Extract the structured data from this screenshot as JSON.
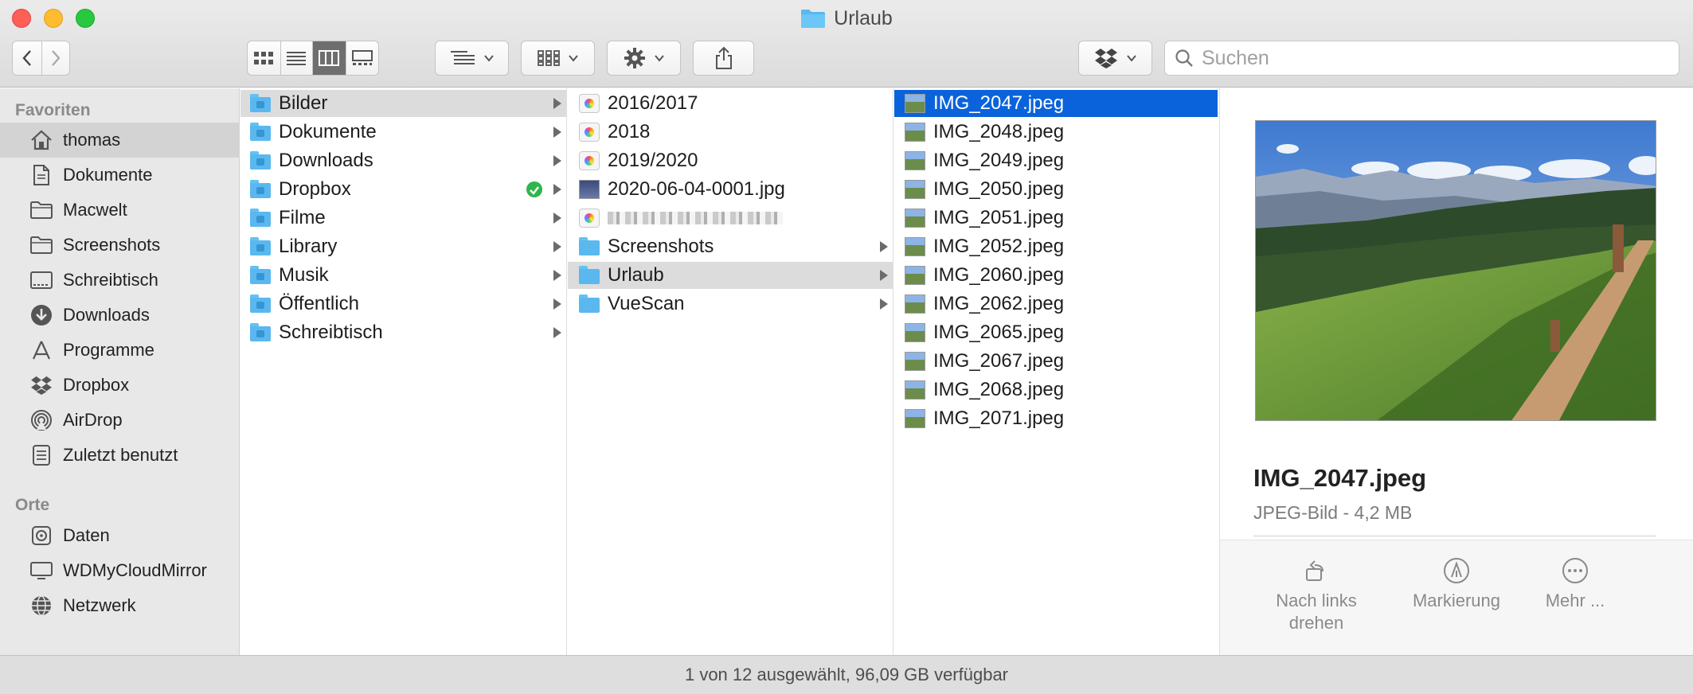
{
  "window": {
    "title": "Urlaub"
  },
  "toolbar": {
    "back_icon": "chevron-left-icon",
    "forward_icon": "chevron-right-icon",
    "view_modes": [
      "icon-view",
      "list-view",
      "column-view",
      "gallery-view"
    ],
    "active_view": "column-view",
    "search_placeholder": "Suchen"
  },
  "sidebar": {
    "favorites_header": "Favoriten",
    "favorites": [
      {
        "label": "thomas",
        "icon": "home-icon",
        "selected": true
      },
      {
        "label": "Dokumente",
        "icon": "document-icon"
      },
      {
        "label": "Macwelt",
        "icon": "folder-icon"
      },
      {
        "label": "Screenshots",
        "icon": "folder-icon"
      },
      {
        "label": "Schreibtisch",
        "icon": "desktop-icon"
      },
      {
        "label": "Downloads",
        "icon": "download-icon"
      },
      {
        "label": "Programme",
        "icon": "applications-icon"
      },
      {
        "label": "Dropbox",
        "icon": "dropbox-icon"
      },
      {
        "label": "AirDrop",
        "icon": "airdrop-icon"
      },
      {
        "label": "Zuletzt benutzt",
        "icon": "recents-icon"
      }
    ],
    "locations_header": "Orte",
    "locations": [
      {
        "label": "Daten",
        "icon": "disk-icon"
      },
      {
        "label": "WDMyCloudMirror",
        "icon": "display-icon"
      },
      {
        "label": "Netzwerk",
        "icon": "network-icon"
      }
    ]
  },
  "columns": {
    "col1": [
      {
        "label": "Bilder",
        "selected": true
      },
      {
        "label": "Dokumente"
      },
      {
        "label": "Downloads"
      },
      {
        "label": "Dropbox",
        "synced": true
      },
      {
        "label": "Filme"
      },
      {
        "label": "Library"
      },
      {
        "label": "Musik"
      },
      {
        "label": "Öffentlich"
      },
      {
        "label": "Schreibtisch"
      }
    ],
    "col2": [
      {
        "label": "2016/2017",
        "kind": "photos"
      },
      {
        "label": "2018",
        "kind": "photos"
      },
      {
        "label": "2019/2020",
        "kind": "photos"
      },
      {
        "label": "2020-06-04-0001.jpg",
        "kind": "jpg"
      },
      {
        "label": "",
        "kind": "photos",
        "blurred": true
      },
      {
        "label": "Screenshots",
        "kind": "folder"
      },
      {
        "label": "Urlaub",
        "kind": "folder",
        "selected": true
      },
      {
        "label": "VueScan",
        "kind": "folder"
      }
    ],
    "col3": [
      "IMG_2047.jpeg",
      "IMG_2048.jpeg",
      "IMG_2049.jpeg",
      "IMG_2050.jpeg",
      "IMG_2051.jpeg",
      "IMG_2052.jpeg",
      "IMG_2060.jpeg",
      "IMG_2062.jpeg",
      "IMG_2065.jpeg",
      "IMG_2067.jpeg",
      "IMG_2068.jpeg",
      "IMG_2071.jpeg"
    ],
    "col3_selected": "IMG_2047.jpeg"
  },
  "preview": {
    "name": "IMG_2047.jpeg",
    "type": "JPEG-Bild - 4,2 MB",
    "actions": [
      {
        "label": "Nach links drehen",
        "icon": "rotate-left-icon"
      },
      {
        "label": "Markierung",
        "icon": "markup-icon"
      },
      {
        "label": "Mehr ...",
        "icon": "more-icon"
      }
    ]
  },
  "status": {
    "text": "1 von 12 ausgewählt, 96,09 GB verfügbar"
  },
  "colors": {
    "selection_blue": "#0a63da",
    "folder_blue": "#5ab8ef",
    "sync_green": "#2fb54c"
  }
}
